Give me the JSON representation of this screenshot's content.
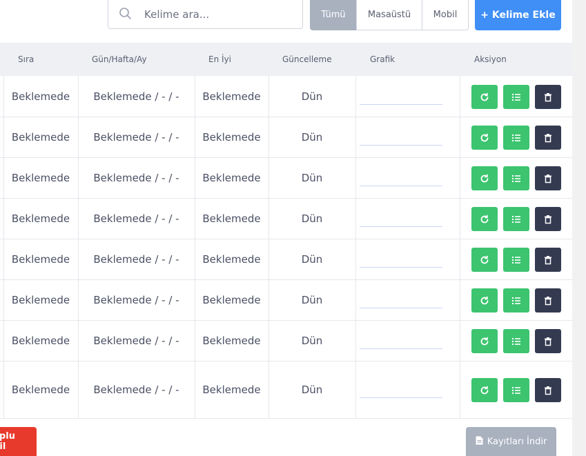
{
  "toolbar": {
    "search_placeholder": "Kelime ara...",
    "filters": [
      {
        "label": "Tümü",
        "active": true
      },
      {
        "label": "Masaüstü",
        "active": false
      },
      {
        "label": "Mobil",
        "active": false
      }
    ],
    "add_label": "+ Kelime Ekle"
  },
  "table": {
    "headers": [
      "Sıra",
      "Gün/Hafta/Ay",
      "En İyi",
      "Güncelleme",
      "Grafik",
      "Aksiyon"
    ],
    "rows": [
      {
        "rank": "Beklemede",
        "period": "Beklemede / - / -",
        "best": "Beklemede",
        "updated": "Dün"
      },
      {
        "rank": "Beklemede",
        "period": "Beklemede / - / -",
        "best": "Beklemede",
        "updated": "Dün"
      },
      {
        "rank": "Beklemede",
        "period": "Beklemede / - / -",
        "best": "Beklemede",
        "updated": "Dün"
      },
      {
        "rank": "Beklemede",
        "period": "Beklemede / - / -",
        "best": "Beklemede",
        "updated": "Dün"
      },
      {
        "rank": "Beklemede",
        "period": "Beklemede / - / -",
        "best": "Beklemede",
        "updated": "Dün"
      },
      {
        "rank": "Beklemede",
        "period": "Beklemede / - / -",
        "best": "Beklemede",
        "updated": "Dün"
      },
      {
        "rank": "Beklemede",
        "period": "Beklemede / - / -",
        "best": "Beklemede",
        "updated": "Dün"
      },
      {
        "rank": "Beklemede",
        "period": "Beklemede / - / -",
        "best": "Beklemede",
        "updated": "Dün"
      }
    ]
  },
  "footer": {
    "bulk_delete_label": "oplu Sil",
    "download_label": "Kayıtları İndir"
  },
  "colors": {
    "primary": "#3f8ff7",
    "success": "#3cc46f",
    "dark": "#343a50",
    "danger": "#e8392d",
    "muted": "#a9b1bf"
  }
}
